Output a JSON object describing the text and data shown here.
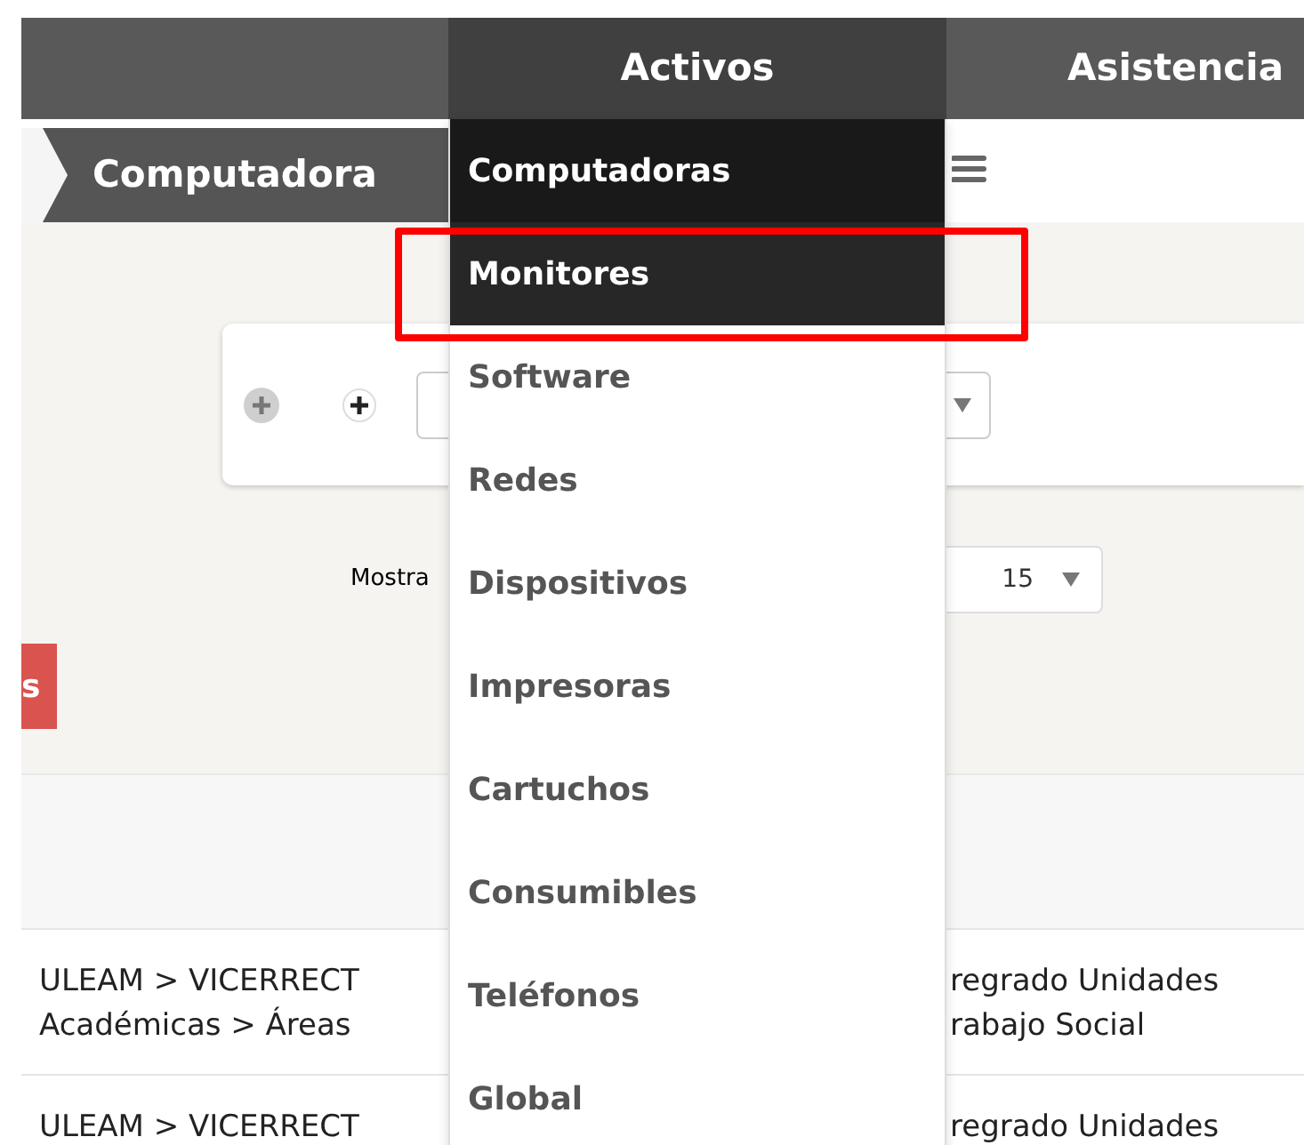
{
  "top_menu": [
    {
      "label": "Activos",
      "selected": true
    },
    {
      "label": "Asistencia",
      "selected": false
    }
  ],
  "breadcrumb": {
    "title": "Computadora"
  },
  "activos_menu": [
    {
      "label": "Computadoras",
      "selected": true,
      "hovered": false
    },
    {
      "label": "Monitores",
      "selected": false,
      "hovered": true
    },
    {
      "label": "Software",
      "selected": false,
      "hovered": false
    },
    {
      "label": "Redes",
      "selected": false,
      "hovered": false
    },
    {
      "label": "Dispositivos",
      "selected": false,
      "hovered": false
    },
    {
      "label": "Impresoras",
      "selected": false,
      "hovered": false
    },
    {
      "label": "Cartuchos",
      "selected": false,
      "hovered": false
    },
    {
      "label": "Consumibles",
      "selected": false,
      "hovered": false
    },
    {
      "label": "Teléfonos",
      "selected": false,
      "hovered": false
    },
    {
      "label": "Global",
      "selected": false,
      "hovered": false
    }
  ],
  "search": {
    "count_label": "Mostra",
    "page_size": "15"
  },
  "side_button": {
    "label": "s"
  },
  "table": {
    "rows": [
      {
        "left": [
          "ULEAM > VICERRECT",
          "Académicas > Áreas"
        ],
        "right": [
          "regrado Unidades",
          "rabajo Social"
        ]
      },
      {
        "left": [
          "ULEAM > VICERRECT"
        ],
        "right": [
          "regrado Unidades"
        ]
      }
    ]
  }
}
